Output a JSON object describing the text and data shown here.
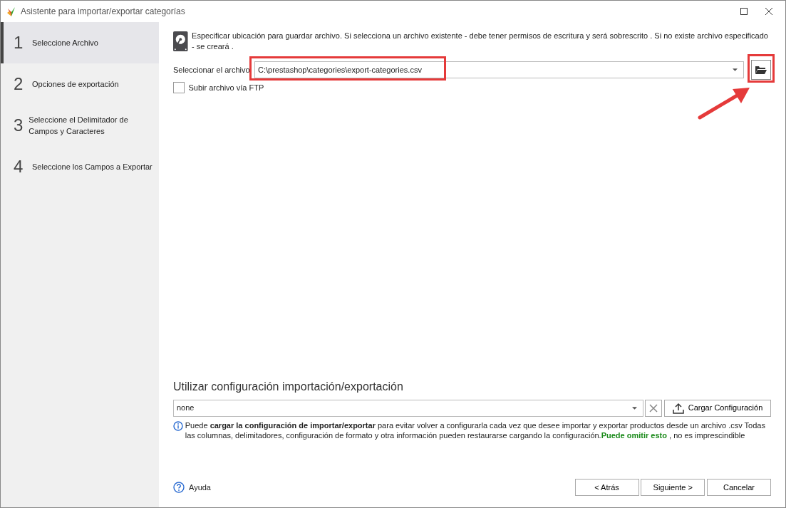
{
  "window": {
    "title": "Asistente para importar/exportar categorías"
  },
  "steps": [
    {
      "number": "1",
      "label": "Seleccione Archivo",
      "selected": true
    },
    {
      "number": "2",
      "label": "Opciones de exportación",
      "selected": false
    },
    {
      "number": "3",
      "label": "Seleccione el Delimitador de Campos y Caracteres",
      "selected": false
    },
    {
      "number": "4",
      "label": "Seleccione los Campos a Exportar",
      "selected": false
    }
  ],
  "description": "Especificar ubicación para guardar archivo. Si selecciona un archivo existente - debe tener permisos de escritura y será sobrescrito . Si no existe archivo especificado - se creará .",
  "file": {
    "label": "Seleccionar el archivo",
    "value": "C:\\prestashop\\categories\\export-categories.csv"
  },
  "ftp": {
    "label": "Subir archivo vía FTP",
    "checked": false
  },
  "config": {
    "heading": "Utilizar configuración importación/exportación",
    "value": "none",
    "load_button": "Cargar Configuración"
  },
  "info": [
    {
      "kind": "plain",
      "text": "Puede "
    },
    {
      "kind": "bold",
      "text": "cargar la configuración de importar/exportar"
    },
    {
      "kind": "plain",
      "text": " para evitar volver a configurarla cada vez que desee importar y exportar productos desde un archivo .csv Todas las columnas, delimitadores, configuración de formato y otra información pueden restaurarse cargando la configuración."
    },
    {
      "kind": "green",
      "text": "Puede omitir esto"
    },
    {
      "kind": "plain",
      "text": " , no es imprescindible"
    }
  ],
  "help": "Ayuda",
  "buttons": [
    {
      "label": "< Atrás"
    },
    {
      "label": "Siguiente >"
    },
    {
      "label": "Cancelar"
    }
  ]
}
